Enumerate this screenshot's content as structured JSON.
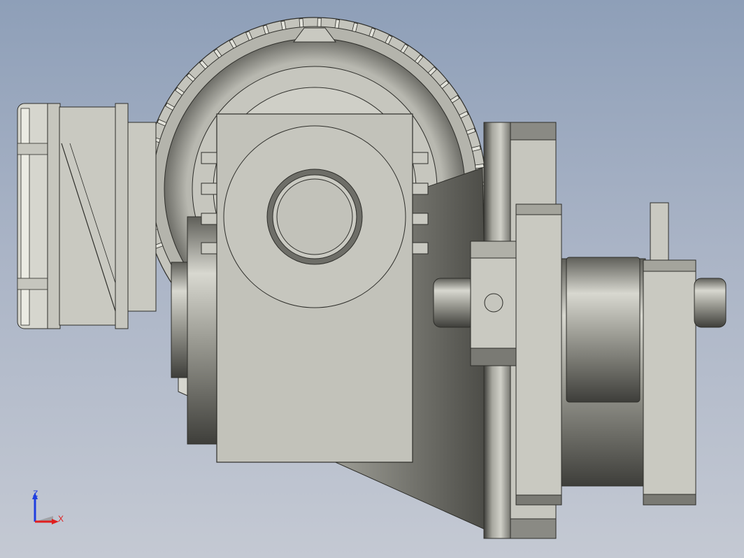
{
  "viewport": {
    "background_top": "#8e9fb8",
    "background_bottom": "#c4c9d3",
    "model_colors": {
      "face_light": "#c9c9c1",
      "face_mid": "#b9b9b1",
      "face_dark": "#6e6e68",
      "edge": "#2e2e2a"
    }
  },
  "triad": {
    "z_label": "Z",
    "x_label": "X",
    "z_color": "#1f3fe0",
    "x_color": "#e01f1f",
    "y_color": "#2ab02a"
  }
}
